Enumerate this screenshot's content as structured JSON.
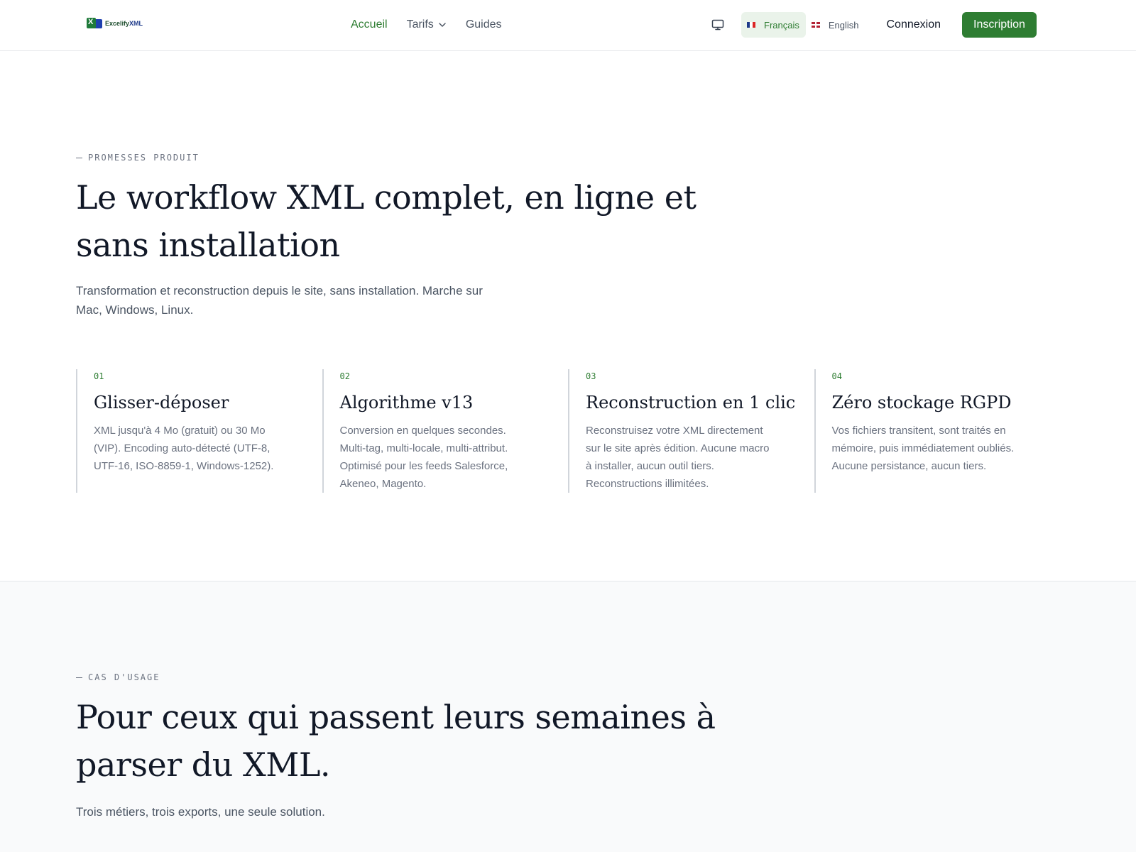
{
  "header": {
    "logo": {
      "text_main": "Excelify",
      "text_accent": "XML"
    },
    "nav": [
      {
        "label": "Accueil",
        "active": true
      },
      {
        "label": "Tarifs",
        "has_dropdown": true
      },
      {
        "label": "Guides"
      }
    ],
    "display_icon": "monitor-icon",
    "languages": [
      {
        "label": "Français",
        "flag": "fr",
        "active": true
      },
      {
        "label": "English",
        "flag": "uk",
        "active": false
      }
    ],
    "login_label": "Connexion",
    "signup_label": "Inscription"
  },
  "promises": {
    "eyebrow": "PROMESSES PRODUIT",
    "title_line1": "Le workflow XML complet, en ligne et",
    "title_line2": "sans installation",
    "lead_line1": "Transformation et reconstruction depuis le site, sans installation. Marche sur",
    "lead_line2": "Mac, Windows, Linux.",
    "features": [
      {
        "num": "01",
        "title": "Glisser-déposer",
        "desc_lines": [
          "XML jusqu'à 4 Mo (gratuit) ou 30 Mo",
          "(VIP). Encoding auto-détecté (UTF-8,",
          "UTF-16, ISO-8859-1, Windows-1252)."
        ]
      },
      {
        "num": "02",
        "title": "Algorithme v13",
        "desc_lines": [
          "Conversion en quelques secondes.",
          "Multi-tag, multi-locale, multi-attribut.",
          "Optimisé pour les feeds Salesforce,",
          "Akeneo, Magento."
        ]
      },
      {
        "num": "03",
        "title": "Reconstruction en 1 clic",
        "desc_lines": [
          "Reconstruisez votre XML directement",
          "sur le site après édition. Aucune macro",
          "à installer, aucun outil tiers.",
          "Reconstructions illimitées."
        ]
      },
      {
        "num": "04",
        "title": "Zéro stockage RGPD",
        "desc_lines": [
          "Vos fichiers transitent, sont traités en",
          "mémoire, puis immédiatement oubliés.",
          "Aucune persistance, aucun tiers."
        ]
      }
    ]
  },
  "use_cases": {
    "eyebrow": "CAS D'USAGE",
    "title_line1": "Pour ceux qui passent leurs semaines à",
    "title_line2": "parser du XML.",
    "lead": "Trois métiers, trois exports, une seule solution."
  },
  "colors": {
    "brand_green": "#2e7d32",
    "active_lang_bg": "#eaf3ea",
    "text_dark": "#111827",
    "text_muted": "#6b7280"
  }
}
